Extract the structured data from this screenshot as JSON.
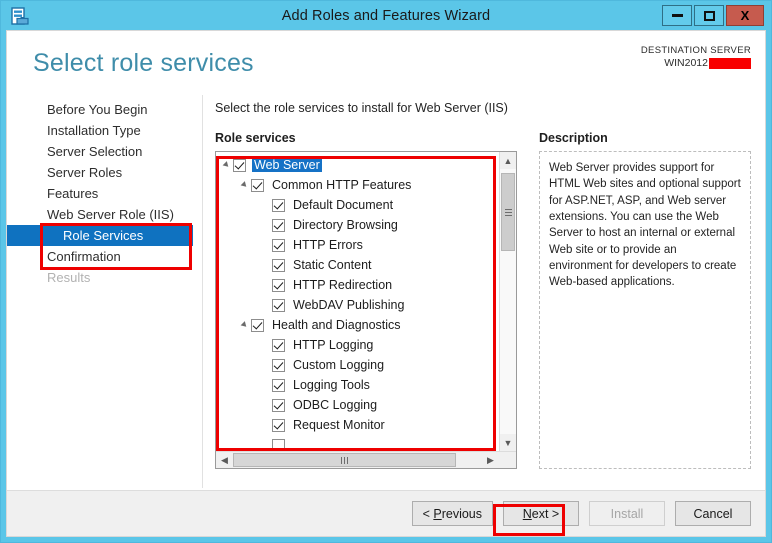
{
  "window": {
    "title": "Add Roles and Features Wizard",
    "app_icon": "server-wizard-icon",
    "controls": {
      "minimize": "minimize-icon",
      "maximize": "maximize-icon",
      "close": "X"
    }
  },
  "header": {
    "page_title": "Select role services",
    "destination_label": "DESTINATION SERVER",
    "destination_server": "WIN2012",
    "redacted": true
  },
  "sidebar": {
    "items": [
      {
        "label": "Before You Begin",
        "state": "normal",
        "level": 0
      },
      {
        "label": "Installation Type",
        "state": "normal",
        "level": 0
      },
      {
        "label": "Server Selection",
        "state": "normal",
        "level": 0
      },
      {
        "label": "Server Roles",
        "state": "normal",
        "level": 0
      },
      {
        "label": "Features",
        "state": "normal",
        "level": 0
      },
      {
        "label": "Web Server Role (IIS)",
        "state": "normal",
        "level": 0
      },
      {
        "label": "Role Services",
        "state": "selected",
        "level": 1
      },
      {
        "label": "Confirmation",
        "state": "normal",
        "level": 0
      },
      {
        "label": "Results",
        "state": "disabled",
        "level": 0
      }
    ]
  },
  "pane": {
    "instruction": "Select the role services to install for Web Server (IIS)",
    "role_services_label": "Role services",
    "description_label": "Description",
    "description_text": "Web Server provides support for HTML Web sites and optional support for ASP.NET, ASP, and Web server extensions. You can use the Web Server to host an internal or external Web site or to provide an environment for developers to create Web-based applications."
  },
  "tree": {
    "nodes": [
      {
        "label": "Web Server",
        "level": 0,
        "checked": true,
        "expander": true,
        "selected": true
      },
      {
        "label": "Common HTTP Features",
        "level": 1,
        "checked": true,
        "expander": true,
        "selected": false
      },
      {
        "label": "Default Document",
        "level": 2,
        "checked": true,
        "expander": false,
        "selected": false
      },
      {
        "label": "Directory Browsing",
        "level": 2,
        "checked": true,
        "expander": false,
        "selected": false
      },
      {
        "label": "HTTP Errors",
        "level": 2,
        "checked": true,
        "expander": false,
        "selected": false
      },
      {
        "label": "Static Content",
        "level": 2,
        "checked": true,
        "expander": false,
        "selected": false
      },
      {
        "label": "HTTP Redirection",
        "level": 2,
        "checked": true,
        "expander": false,
        "selected": false
      },
      {
        "label": "WebDAV Publishing",
        "level": 2,
        "checked": true,
        "expander": false,
        "selected": false
      },
      {
        "label": "Health and Diagnostics",
        "level": 1,
        "checked": true,
        "expander": true,
        "selected": false
      },
      {
        "label": "HTTP Logging",
        "level": 2,
        "checked": true,
        "expander": false,
        "selected": false
      },
      {
        "label": "Custom Logging",
        "level": 2,
        "checked": true,
        "expander": false,
        "selected": false
      },
      {
        "label": "Logging Tools",
        "level": 2,
        "checked": true,
        "expander": false,
        "selected": false
      },
      {
        "label": "ODBC Logging",
        "level": 2,
        "checked": true,
        "expander": false,
        "selected": false
      },
      {
        "label": "Request Monitor",
        "level": 2,
        "checked": true,
        "expander": false,
        "selected": false
      }
    ],
    "scroll": {
      "vertical_thumb_position": "top",
      "horizontal_thumb_position": "left"
    }
  },
  "footer": {
    "previous": "< Previous",
    "next": "Next >",
    "install": "Install",
    "cancel": "Cancel",
    "install_disabled": true
  },
  "annotations": {
    "accent_color": "#ee0000",
    "boxes": [
      "sidebar-web-server-role-and-role-services",
      "role-services-tree",
      "next-button"
    ]
  },
  "colors": {
    "titlebar": "#5bc6e8",
    "title_accent": "#3f8daa",
    "selection_blue": "#0f72c0",
    "close_button": "#c65b4e",
    "annotation_red": "#ee0000"
  }
}
